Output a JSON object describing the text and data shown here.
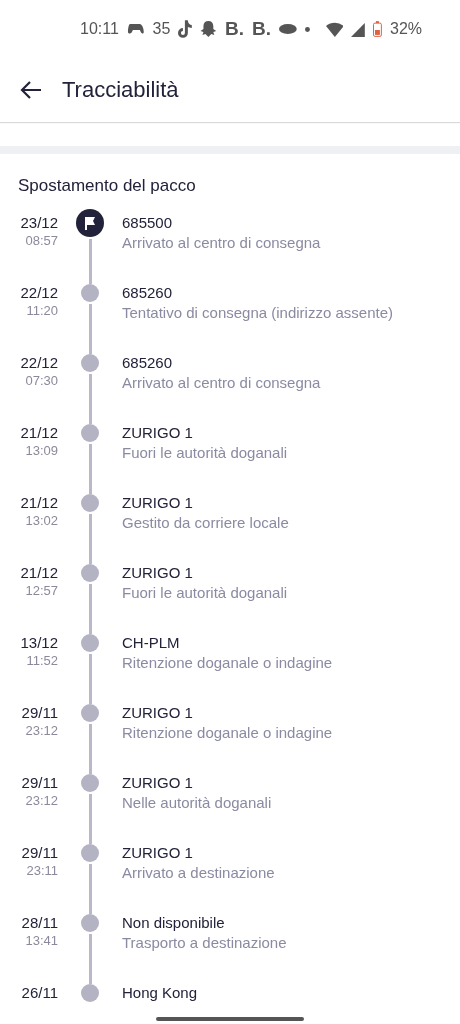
{
  "status_bar": {
    "time": "10:11",
    "notification_count": "35",
    "app_letters": [
      "B.",
      "B."
    ],
    "battery": "32%"
  },
  "header": {
    "title": "Tracciabilità"
  },
  "section": {
    "title": "Spostamento del pacco"
  },
  "events": [
    {
      "date": "23/12",
      "time": "08:57",
      "place": "685500",
      "status": "Arrivato al centro di consegna",
      "current": true
    },
    {
      "date": "22/12",
      "time": "11:20",
      "place": "685260",
      "status": "Tentativo di consegna (indirizzo assente)",
      "current": false
    },
    {
      "date": "22/12",
      "time": "07:30",
      "place": "685260",
      "status": "Arrivato al centro di consegna",
      "current": false
    },
    {
      "date": "21/12",
      "time": "13:09",
      "place": "ZURIGO 1",
      "status": "Fuori le autorità doganali",
      "current": false
    },
    {
      "date": "21/12",
      "time": "13:02",
      "place": "ZURIGO 1",
      "status": "Gestito da corriere locale",
      "current": false
    },
    {
      "date": "21/12",
      "time": "12:57",
      "place": "ZURIGO 1",
      "status": "Fuori le autorità doganali",
      "current": false
    },
    {
      "date": "13/12",
      "time": "11:52",
      "place": "CH-PLM",
      "status": "Ritenzione doganale o indagine",
      "current": false
    },
    {
      "date": "29/11",
      "time": "23:12",
      "place": "ZURIGO 1",
      "status": "Ritenzione doganale o indagine",
      "current": false
    },
    {
      "date": "29/11",
      "time": "23:12",
      "place": "ZURIGO 1",
      "status": "Nelle autorità doganali",
      "current": false
    },
    {
      "date": "29/11",
      "time": "23:11",
      "place": "ZURIGO 1",
      "status": "Arrivato a destinazione",
      "current": false
    },
    {
      "date": "28/11",
      "time": "13:41",
      "place": "Non disponibile",
      "status": "Trasporto a destinazione",
      "current": false
    },
    {
      "date": "26/11",
      "place": "Hong Kong",
      "current": false
    }
  ]
}
